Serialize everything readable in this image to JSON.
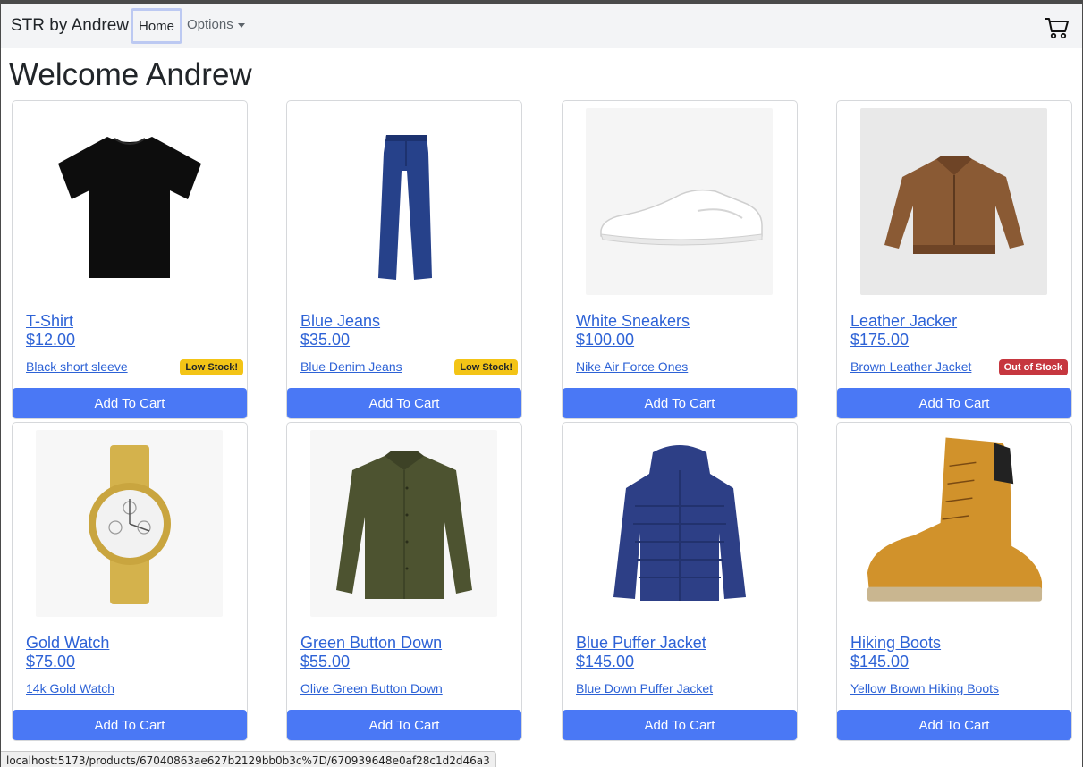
{
  "nav": {
    "brand": "STR by Andrew",
    "home_label": "Home",
    "options_label": "Options",
    "cart_icon": "shopping-cart-icon"
  },
  "page_title": "Welcome Andrew",
  "products": [
    {
      "name": "T-Shirt",
      "price": "$12.00",
      "description": "Black short sleeve",
      "badge": "Low Stock!",
      "badge_type": "low",
      "button": "Add To Cart",
      "image_icon": "t-shirt-image"
    },
    {
      "name": "Blue Jeans",
      "price": "$35.00",
      "description": "Blue Denim Jeans",
      "badge": "Low Stock!",
      "badge_type": "low",
      "button": "Add To Cart",
      "image_icon": "jeans-image"
    },
    {
      "name": "White Sneakers",
      "price": "$100.00",
      "description": "Nike Air Force Ones",
      "badge": "",
      "badge_type": "",
      "button": "Add To Cart",
      "image_icon": "sneaker-image"
    },
    {
      "name": "Leather Jacker",
      "price": "$175.00",
      "description": "Brown Leather Jacket",
      "badge": "Out of Stock",
      "badge_type": "out",
      "button": "Add To Cart",
      "image_icon": "leather-jacket-image"
    },
    {
      "name": "Gold Watch",
      "price": "$75.00",
      "description": "14k Gold Watch",
      "badge": "",
      "badge_type": "",
      "button": "Add To Cart",
      "image_icon": "watch-image"
    },
    {
      "name": "Green Button Down",
      "price": "$55.00",
      "description": "Olive Green Button Down",
      "badge": "",
      "badge_type": "",
      "button": "Add To Cart",
      "image_icon": "shirt-image"
    },
    {
      "name": "Blue Puffer Jacket",
      "price": "$145.00",
      "description": "Blue Down Puffer Jacket",
      "badge": "",
      "badge_type": "",
      "button": "Add To Cart",
      "image_icon": "puffer-jacket-image"
    },
    {
      "name": "Hiking Boots",
      "price": "$145.00",
      "description": "Yellow Brown Hiking Boots",
      "badge": "",
      "badge_type": "",
      "button": "Add To Cart",
      "image_icon": "boot-image"
    }
  ],
  "status_url": "localhost:5173/products/67040863ae627b2129bb0b3c%7D/670939648e0af28c1d2d46a3",
  "colors": {
    "primary_button": "#4a78f5",
    "link": "#2d62d6",
    "low_stock": "#f3c416",
    "out_of_stock": "#c6373f"
  }
}
